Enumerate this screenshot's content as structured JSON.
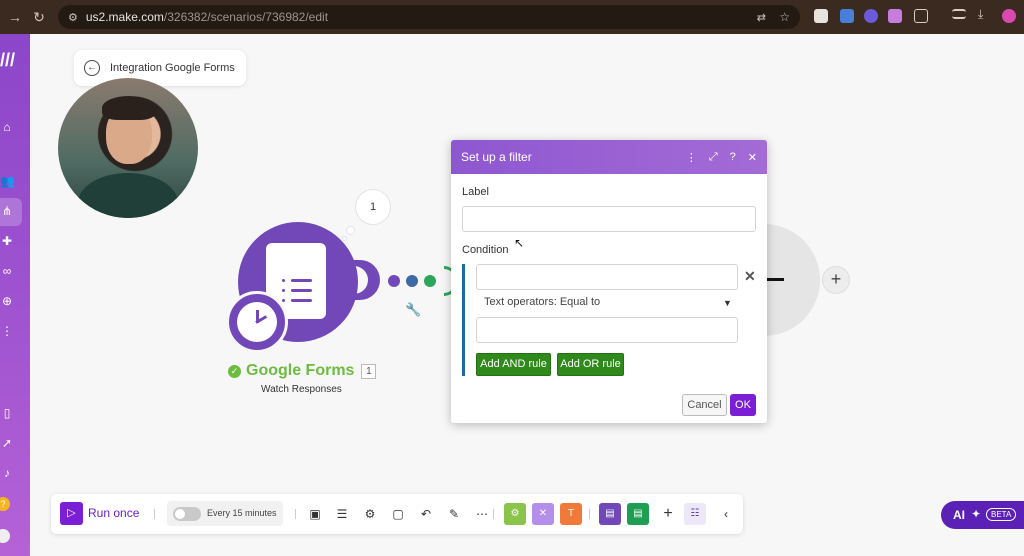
{
  "browser": {
    "url_host": "us2.make.com",
    "url_path": "/326382/scenarios/736982/edit"
  },
  "scenario": {
    "title": "Integration Google Forms"
  },
  "canvas": {
    "bubble_count": "1",
    "module": {
      "name": "Google Forms",
      "badge": "1",
      "subtitle": "Watch Responses"
    }
  },
  "filter_dialog": {
    "title": "Set up a filter",
    "label_caption": "Label",
    "label_value": "",
    "condition_caption": "Condition",
    "first_operand_value": "",
    "operator": "Text operators: Equal to",
    "second_operand_value": "",
    "add_and_rule": "Add AND rule",
    "add_or_rule": "Add OR rule",
    "cancel": "Cancel",
    "ok": "OK"
  },
  "toolbar": {
    "run_once": "Run once",
    "schedule": "Every 15 minutes",
    "schedule_enabled": false
  },
  "ai": {
    "label": "AI",
    "badge": "BETA"
  },
  "colors": {
    "make_purple": "#7a1fd6",
    "module_purple": "#7248b9",
    "success_green": "#6dbc41",
    "rule_green": "#2f8a1b",
    "condition_blue": "#1b6aa5"
  }
}
